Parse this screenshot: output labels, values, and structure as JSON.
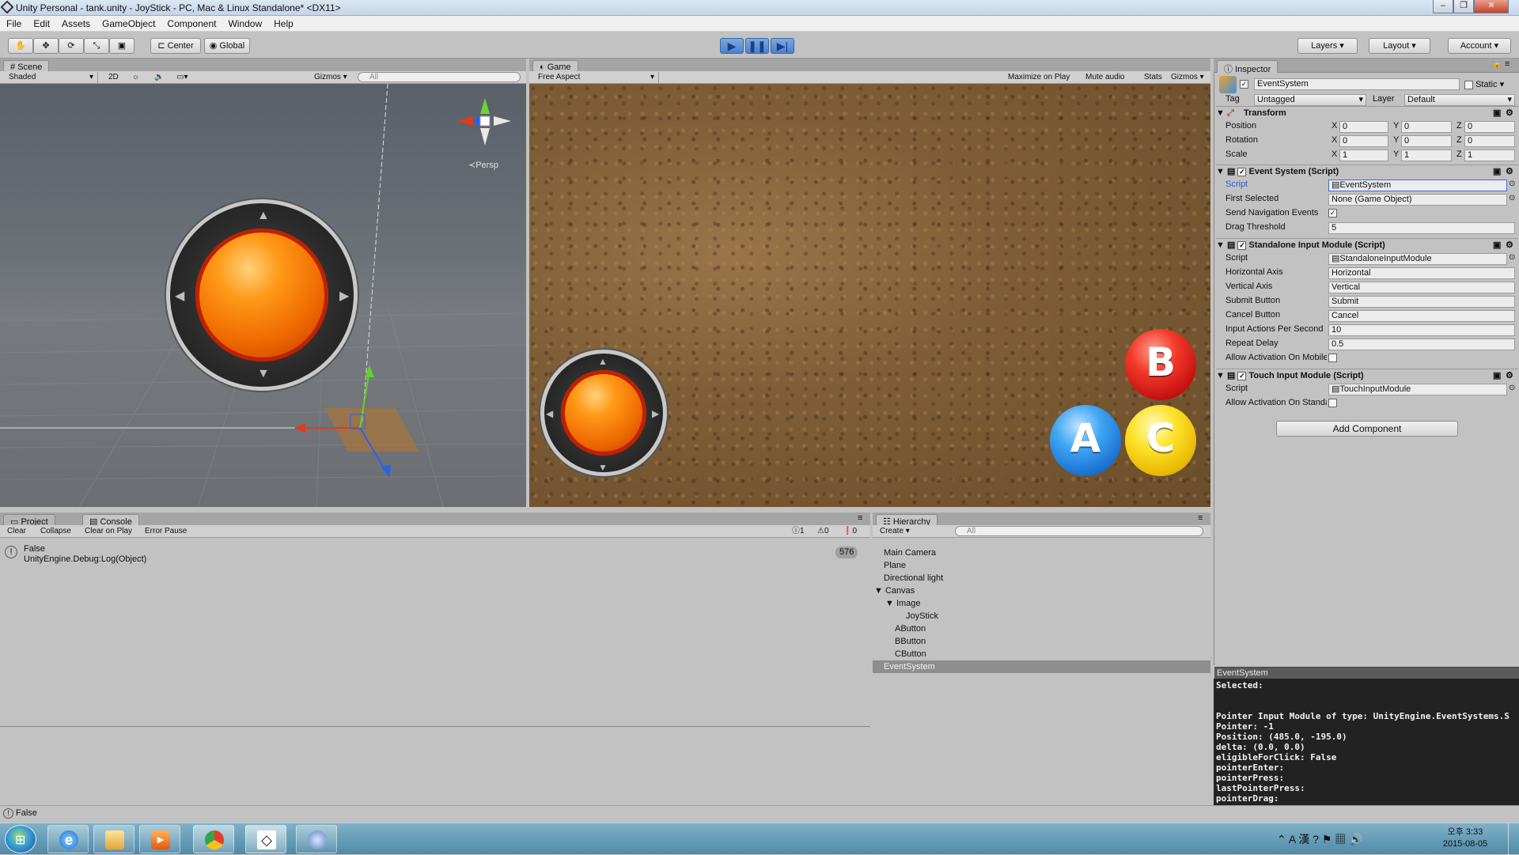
{
  "window": {
    "title": "Unity Personal - tank.unity - JoyStick - PC, Mac & Linux Standalone* <DX11>",
    "controls": [
      "‒",
      "❐",
      "✕"
    ]
  },
  "menu": [
    "File",
    "Edit",
    "Assets",
    "GameObject",
    "Component",
    "Window",
    "Help"
  ],
  "toolbar": {
    "pivot": "Center",
    "space": "Global",
    "layers": "Layers",
    "layout": "Layout",
    "account": "Account"
  },
  "scene": {
    "tab": "Scene",
    "shading": "Shaded",
    "mode2d": "2D",
    "gizmos": "Gizmos",
    "search_placeholder": "All",
    "persp": "Persp"
  },
  "game": {
    "tab": "Game",
    "aspect": "Free Aspect",
    "maximize": "Maximize on Play",
    "mute": "Mute audio",
    "stats": "Stats",
    "gizmos": "Gizmos",
    "buttons": {
      "a": "A",
      "b": "B",
      "c": "C"
    }
  },
  "inspector": {
    "tab": "Inspector",
    "object_name": "EventSystem",
    "static_label": "Static",
    "tag_label": "Tag",
    "tag_value": "Untagged",
    "layer_label": "Layer",
    "layer_value": "Default",
    "transform": {
      "title": "Transform",
      "rows": [
        {
          "label": "Position",
          "x": "0",
          "y": "0",
          "z": "0"
        },
        {
          "label": "Rotation",
          "x": "0",
          "y": "0",
          "z": "0"
        },
        {
          "label": "Scale",
          "x": "1",
          "y": "1",
          "z": "1"
        }
      ]
    },
    "event_system": {
      "title": "Event System (Script)",
      "script_label": "Script",
      "script_value": "EventSystem",
      "first_selected_label": "First Selected",
      "first_selected_value": "None (Game Object)",
      "send_nav_label": "Send Navigation Events",
      "send_nav_checked": true,
      "drag_threshold_label": "Drag Threshold",
      "drag_threshold_value": "5"
    },
    "standalone": {
      "title": "Standalone Input Module (Script)",
      "script_label": "Script",
      "script_value": "StandaloneInputModule",
      "rows": [
        {
          "label": "Horizontal Axis",
          "value": "Horizontal"
        },
        {
          "label": "Vertical Axis",
          "value": "Vertical"
        },
        {
          "label": "Submit Button",
          "value": "Submit"
        },
        {
          "label": "Cancel Button",
          "value": "Cancel"
        },
        {
          "label": "Input Actions Per Second",
          "value": "10"
        },
        {
          "label": "Repeat Delay",
          "value": "0.5"
        }
      ],
      "allow_label": "Allow Activation On Mobile Device",
      "allow_checked": false
    },
    "touch": {
      "title": "Touch Input Module (Script)",
      "script_label": "Script",
      "script_value": "TouchInputModule",
      "allow_label": "Allow Activation On Standalone",
      "allow_checked": false
    },
    "add_component": "Add Component",
    "preview": {
      "title": "EventSystem",
      "lines": [
        "Selected:",
        "",
        "",
        "Pointer Input Module of type: UnityEngine.EventSystems.S",
        "Pointer: -1",
        "Position: (485.0, -195.0)",
        "delta: (0.0, 0.0)",
        "eligibleForClick: False",
        "pointerEnter:",
        "pointerPress:",
        "lastPointerPress:",
        "pointerDrag:"
      ]
    }
  },
  "console": {
    "tab_project": "Project",
    "tab_console": "Console",
    "buttons": [
      "Clear",
      "Collapse",
      "Clear on Play",
      "Error Pause"
    ],
    "counts": {
      "info": "1",
      "warn": "0",
      "error": "0"
    },
    "entry": {
      "line1": "False",
      "line2": "UnityEngine.Debug:Log(Object)",
      "count": "576"
    }
  },
  "hierarchy": {
    "tab": "Hierarchy",
    "create": "Create",
    "search_placeholder": "All",
    "items": [
      {
        "label": "Main Camera",
        "depth": 0
      },
      {
        "label": "Plane",
        "depth": 0
      },
      {
        "label": "Directional light",
        "depth": 0
      },
      {
        "label": "Canvas",
        "depth": 0,
        "expanded": true
      },
      {
        "label": "Image",
        "depth": 1,
        "expanded": true
      },
      {
        "label": "JoyStick",
        "depth": 2
      },
      {
        "label": "AButton",
        "depth": 1
      },
      {
        "label": "BButton",
        "depth": 1
      },
      {
        "label": "CButton",
        "depth": 1
      },
      {
        "label": "EventSystem",
        "depth": 0,
        "selected": true
      }
    ]
  },
  "status": {
    "text": "False"
  },
  "taskbar": {
    "apps": [
      "start",
      "internet-explorer",
      "file-explorer",
      "media-player",
      "chrome",
      "unity",
      "network-app"
    ],
    "tray": {
      "ime": "A 漢",
      "time": "오후 3:33",
      "date": "2015-08-05"
    }
  },
  "colors": {
    "accent": "#4a82cc",
    "selection": "#3d6fd6",
    "orange": "#f06a00"
  }
}
